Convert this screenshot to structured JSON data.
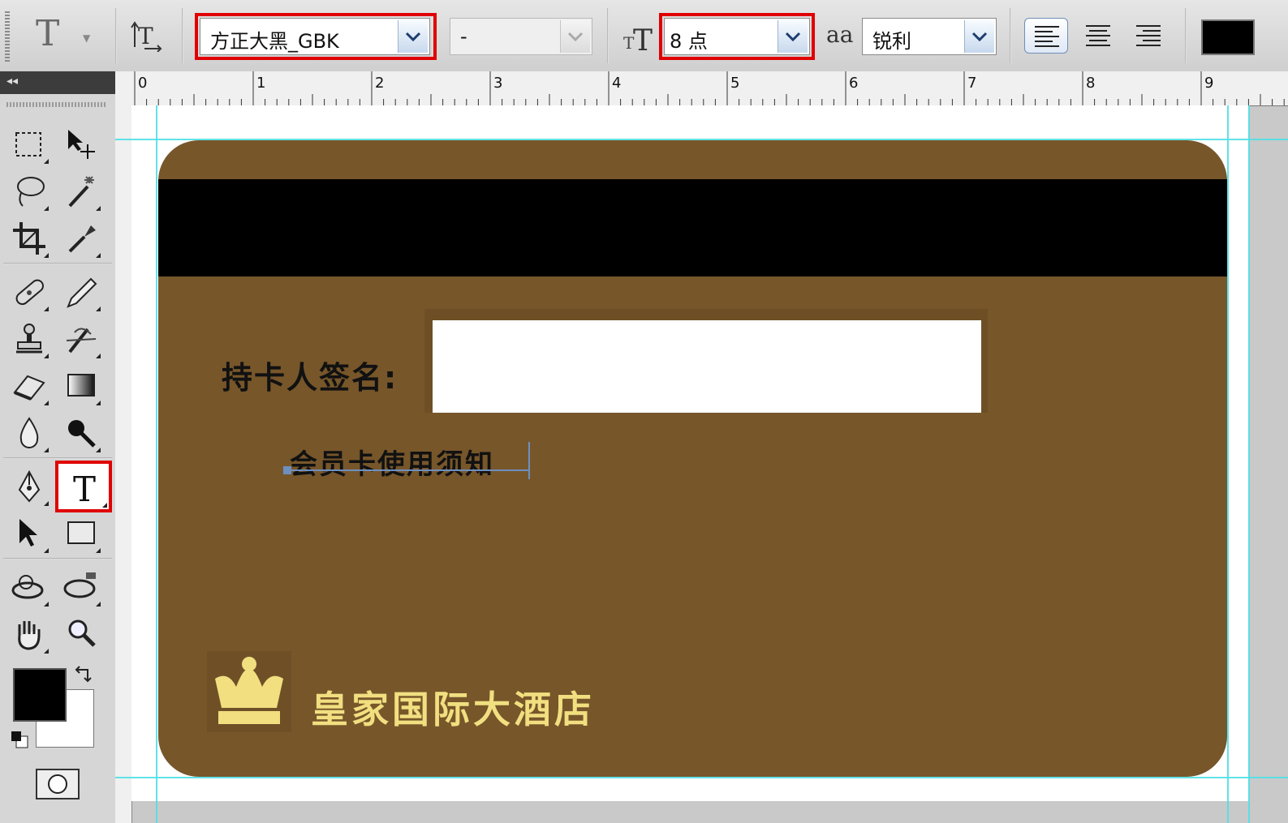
{
  "options_bar": {
    "font_family": "方正大黑_GBK",
    "font_style": "-",
    "font_size": "8 点",
    "antialias": "锐利",
    "antialias_icon_text": "aa",
    "text_color": "#000000"
  },
  "toolbox": {
    "collapse_glyph": "◂◂",
    "active_tool": "type-tool",
    "foreground_color": "#000000",
    "background_color": "#ffffff"
  },
  "ruler": {
    "labels": [
      "0",
      "1",
      "2",
      "3",
      "4",
      "5",
      "6",
      "7",
      "8",
      "9"
    ]
  },
  "document": {
    "card_color": "#77562a",
    "stripe_color": "#000000",
    "signature_label": "持卡人签名:",
    "notice_text": "会员卡使用须知",
    "hotel_name": "皇家国际大酒店",
    "logo_color": "#f1df80"
  },
  "highlight_color": "#e00000"
}
